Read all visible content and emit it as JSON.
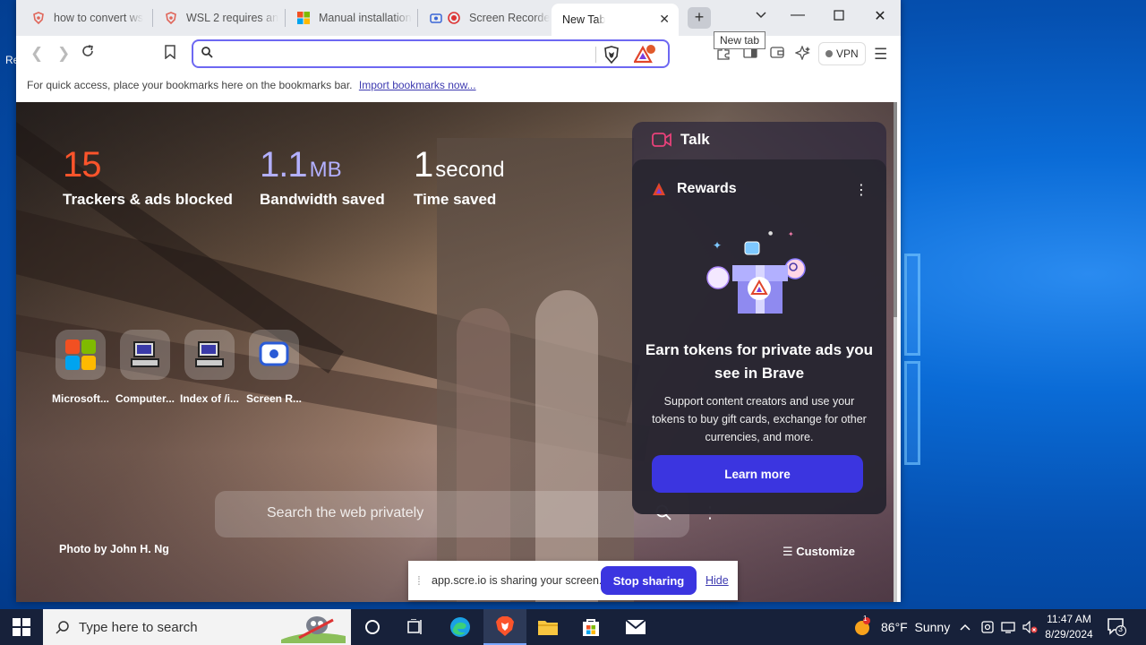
{
  "tabs": [
    {
      "title": "how to convert ws"
    },
    {
      "title": "WSL 2 requires an"
    },
    {
      "title": "Manual installation"
    },
    {
      "title": "Screen Recorde"
    },
    {
      "title": "New Tab"
    }
  ],
  "tooltip": "New tab",
  "toolbar": {
    "search_value": "",
    "vpn_label": "VPN"
  },
  "bookmarks_bar": {
    "text": "For quick access, place your bookmarks here on the bookmarks bar.",
    "link": "Import bookmarks now..."
  },
  "stats": [
    {
      "value": "15",
      "unit": "",
      "label": "Trackers & ads blocked",
      "color": "#fb542b"
    },
    {
      "value": "1.1",
      "unit": "MB",
      "label": "Bandwidth saved",
      "color": "#b3b0ff"
    },
    {
      "value": "1",
      "unit": "second",
      "label": "Time saved",
      "color": "#ffffff"
    }
  ],
  "top_sites": [
    {
      "name": "Microsoft...",
      "icon": "microsoft-logo-icon"
    },
    {
      "name": "Computer...",
      "icon": "computer-icon"
    },
    {
      "name": "Index of /i...",
      "icon": "computer-icon"
    },
    {
      "name": "Screen R...",
      "icon": "screen-recorder-icon"
    }
  ],
  "ntp_search": {
    "placeholder": "Search the web privately"
  },
  "photo_credit": "Photo by John H. Ng",
  "customize_label": "Customize",
  "widgets": {
    "talk_label": "Talk",
    "rewards": {
      "title": "Rewards",
      "headline": "Earn tokens for private ads you see in Brave",
      "body": "Support content creators and use your tokens to buy gift cards, exchange for other currencies, and more.",
      "button": "Learn more"
    }
  },
  "share_bar": {
    "message": "app.scre.io is sharing your screen.",
    "stop_label": "Stop sharing",
    "hide_label": "Hide"
  },
  "taskbar": {
    "search_placeholder": "Type here to search",
    "weather": "86°F  Sunny",
    "weather_badge": "1",
    "time": "11:47 AM",
    "date": "8/29/2024",
    "notification_count": "3"
  },
  "desktop_sliver_text": "Re",
  "colors": {
    "accent": "#3b35e0",
    "brave_orange": "#fb542b",
    "taskbar": "#17213a"
  }
}
